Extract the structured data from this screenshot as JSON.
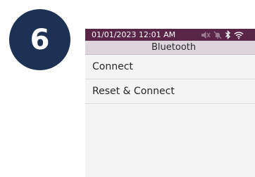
{
  "step": {
    "number": "6",
    "badge_color": "#1c3153"
  },
  "status_bar": {
    "datetime": "01/01/2023 12:01 AM",
    "background": "#5b2548",
    "icons": [
      "mute-icon",
      "notifications-off-icon",
      "bluetooth-icon",
      "wifi-icon"
    ]
  },
  "header": {
    "title": "Bluetooth"
  },
  "menu": {
    "items": [
      {
        "label": "Connect"
      },
      {
        "label": "Reset & Connect"
      }
    ]
  }
}
